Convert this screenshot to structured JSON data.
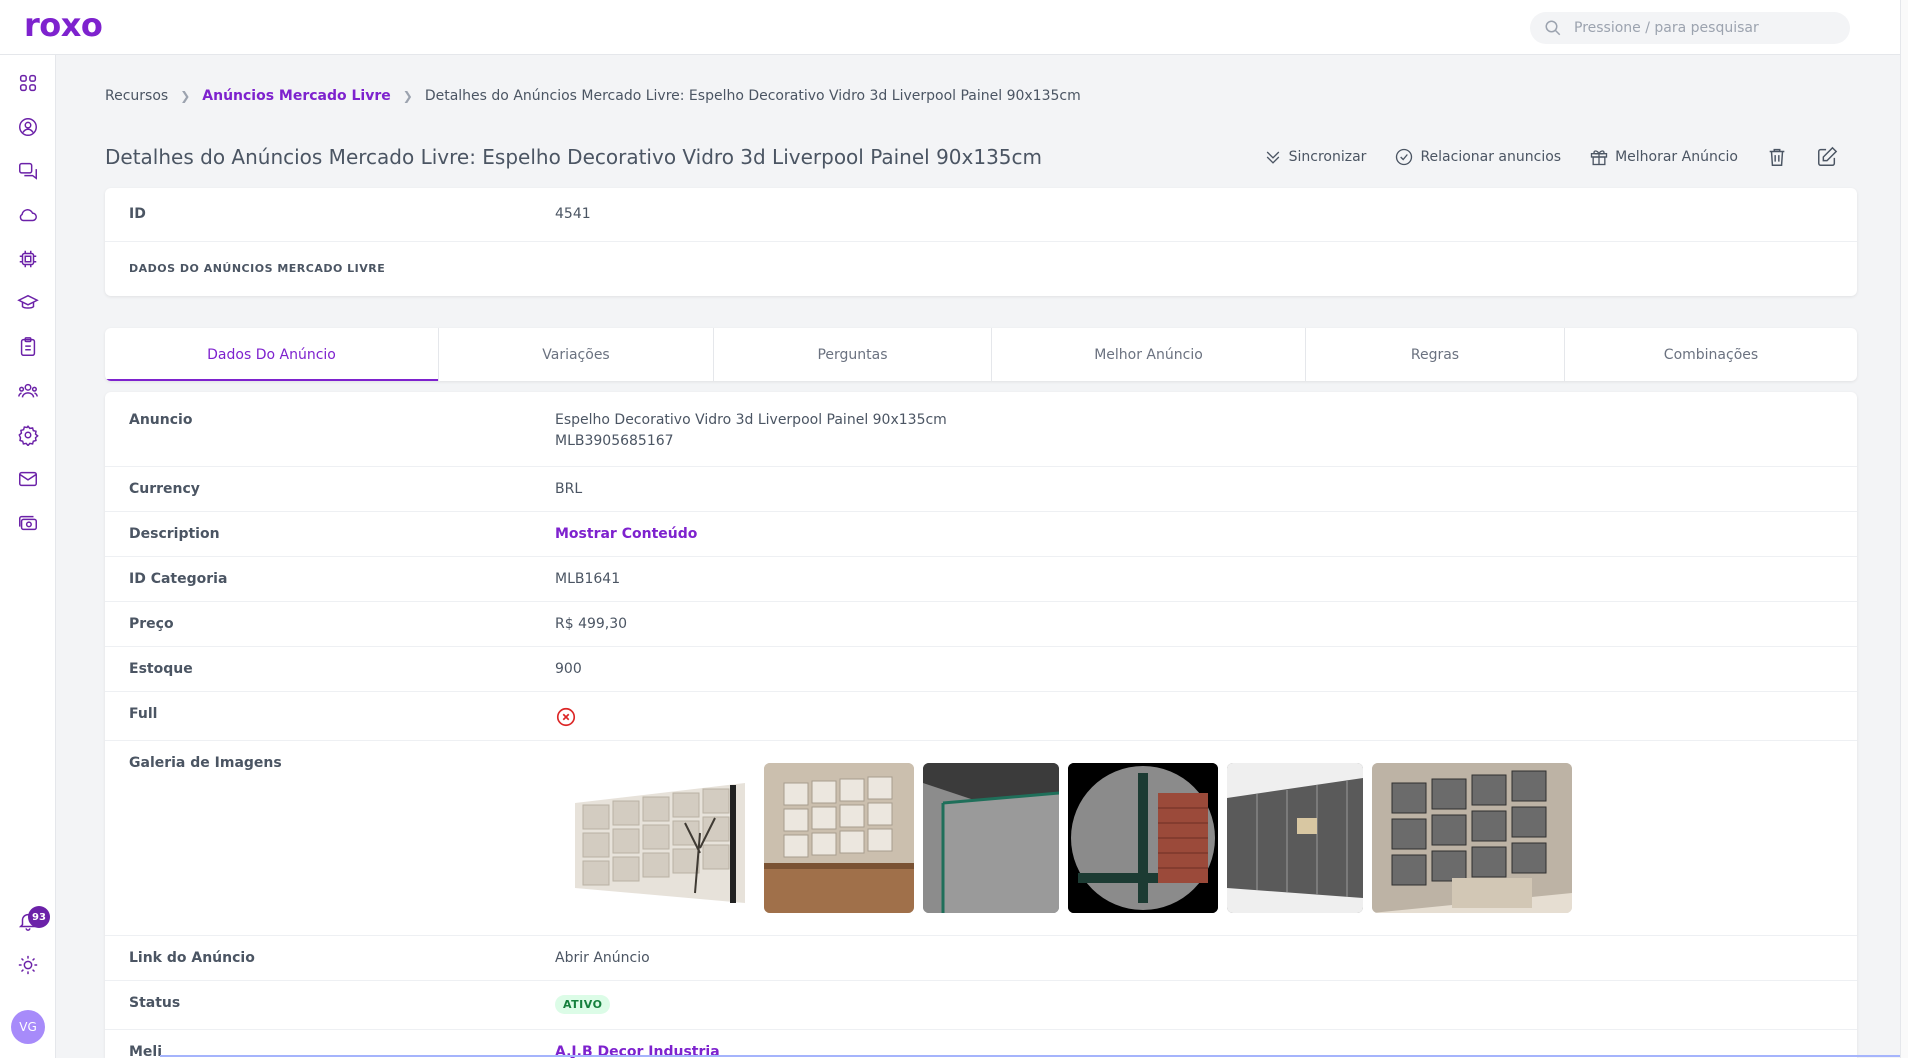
{
  "app": {
    "logo": "roxo"
  },
  "search": {
    "placeholder": "Pressione / para pesquisar"
  },
  "sidebar": {
    "icons": [
      "dashboard-icon",
      "user-circle-icon",
      "chat-icon",
      "cloud-icon",
      "chip-icon",
      "graduation-cap-icon",
      "clipboard-icon",
      "users-icon",
      "gear-icon",
      "mail-icon",
      "money-icon"
    ],
    "notifications_count": "93",
    "avatar_initials": "VG"
  },
  "breadcrumb": {
    "items": [
      "Recursos",
      "Anúncios Mercado Livre",
      "Detalhes do Anúncios Mercado Livre: Espelho Decorativo Vidro 3d Liverpool Painel 90x135cm"
    ]
  },
  "page": {
    "title": "Detalhes do Anúncios Mercado Livre: Espelho Decorativo Vidro 3d Liverpool Painel 90x135cm"
  },
  "actions": {
    "sync": "Sincronizar",
    "relate": "Relacionar anuncios",
    "improve": "Melhorar Anúncio"
  },
  "summary": {
    "id_label": "ID",
    "id_value": "4541",
    "section_heading": "DADOS DO ANÚNCIOS MERCADO LIVRE"
  },
  "tabs": [
    "Dados Do Anúncio",
    "Variações",
    "Perguntas",
    "Melhor Anúncio",
    "Regras",
    "Combinações"
  ],
  "details": {
    "anuncio_label": "Anuncio",
    "anuncio_title": "Espelho Decorativo Vidro 3d Liverpool Painel 90x135cm",
    "anuncio_code": "MLB3905685167",
    "currency_label": "Currency",
    "currency_value": "BRL",
    "description_label": "Description",
    "description_value": "Mostrar Conteúdo",
    "categoria_label": "ID Categoria",
    "categoria_value": "MLB1641",
    "preco_label": "Preço",
    "preco_value": "R$ 499,30",
    "estoque_label": "Estoque",
    "estoque_value": "900",
    "full_label": "Full",
    "galeria_label": "Galeria de Imagens",
    "link_label": "Link do Anúncio",
    "link_value": "Abrir Anúncio",
    "status_label": "Status",
    "status_value": "ATIVO",
    "meli_label": "Meli",
    "meli_value": "A.J.B Decor Industria"
  },
  "colors": {
    "accent": "#7e22ce",
    "status_bg": "#dcfce7",
    "status_fg": "#15803d",
    "error": "#dc2626"
  }
}
